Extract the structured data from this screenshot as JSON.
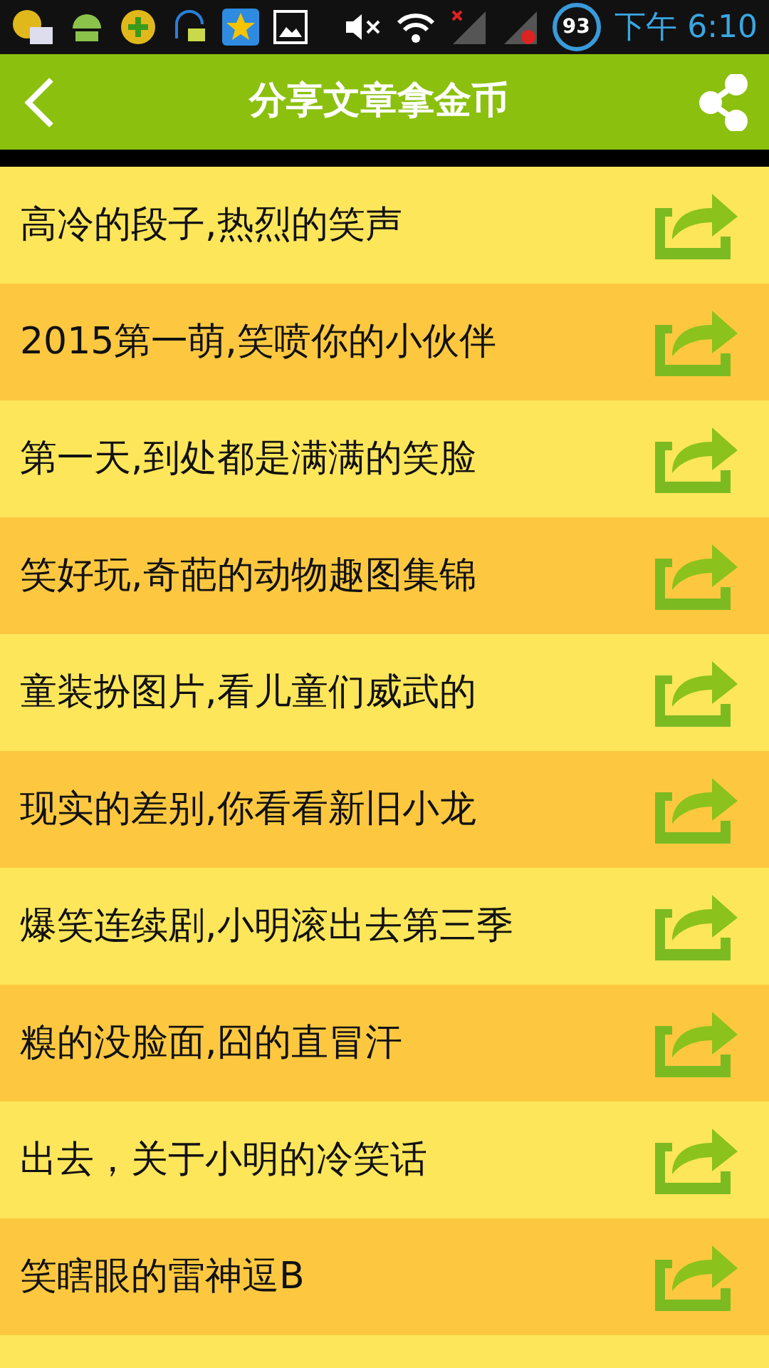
{
  "status_bar": {
    "battery": "93",
    "time": "下午 6:10"
  },
  "header": {
    "title": "分享文章拿金币"
  },
  "articles": [
    {
      "title": "高冷的段子,热烈的笑声"
    },
    {
      "title": "2015第一萌,笑喷你的小伙伴"
    },
    {
      "title": "第一天,到处都是满满的笑脸"
    },
    {
      "title": "笑好玩,奇葩的动物趣图集锦"
    },
    {
      "title": "童装扮图片,看儿童们威武的"
    },
    {
      "title": "现实的差别,你看看新旧小龙"
    },
    {
      "title": "爆笑连续剧,小明滚出去第三季"
    },
    {
      "title": "糗的没脸面,囧的直冒汗"
    },
    {
      "title": "出去，关于小明的冷笑话"
    },
    {
      "title": "笑瞎眼的雷神逗B"
    }
  ]
}
